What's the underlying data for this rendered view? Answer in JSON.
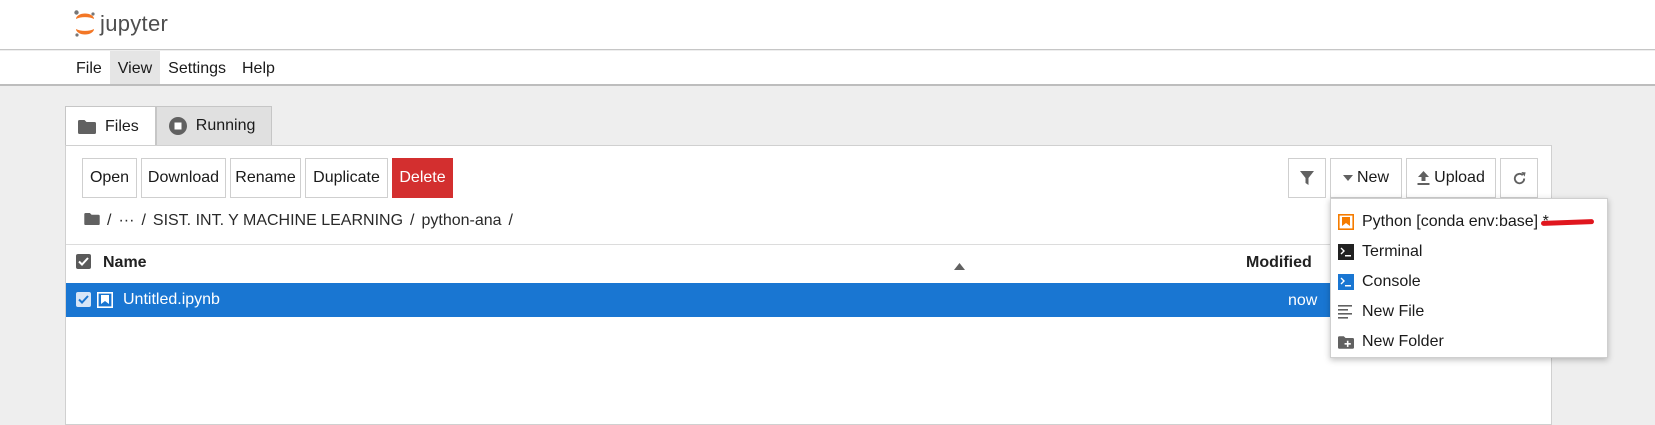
{
  "app": {
    "logo_text": "jupyter"
  },
  "menu": [
    "File",
    "View",
    "Settings",
    "Help"
  ],
  "tabs": [
    {
      "label": "Files",
      "active": true
    },
    {
      "label": "Running",
      "active": false
    }
  ],
  "toolbar": {
    "open": "Open",
    "download": "Download",
    "rename": "Rename",
    "duplicate": "Duplicate",
    "delete": "Delete",
    "new": "New",
    "upload": "Upload"
  },
  "breadcrumbs": {
    "root": "/",
    "ellipsis": "···",
    "path1": "SIST. INT. Y MACHINE LEARNING",
    "sep": "/",
    "path2": "python-ana",
    "end": "/"
  },
  "list": {
    "headers": {
      "name": "Name",
      "modified": "Modified"
    },
    "rows": [
      {
        "name": "Untitled.ipynb",
        "modified": "now",
        "selected": true
      }
    ]
  },
  "new_menu": [
    {
      "label": "Python [conda env:base] *",
      "icon": "notebook-icon",
      "color": "#f57c00"
    },
    {
      "label": "Terminal",
      "icon": "terminal-icon",
      "color": "#212121"
    },
    {
      "label": "Console",
      "icon": "console-icon",
      "color": "#1976d2"
    },
    {
      "label": "New File",
      "icon": "text-file-icon",
      "color": "#616161"
    },
    {
      "label": "New Folder",
      "icon": "new-folder-icon",
      "color": "#616161"
    }
  ],
  "colors": {
    "accent": "#1976d2",
    "danger": "#d32f2f",
    "brand": "#f37726"
  }
}
